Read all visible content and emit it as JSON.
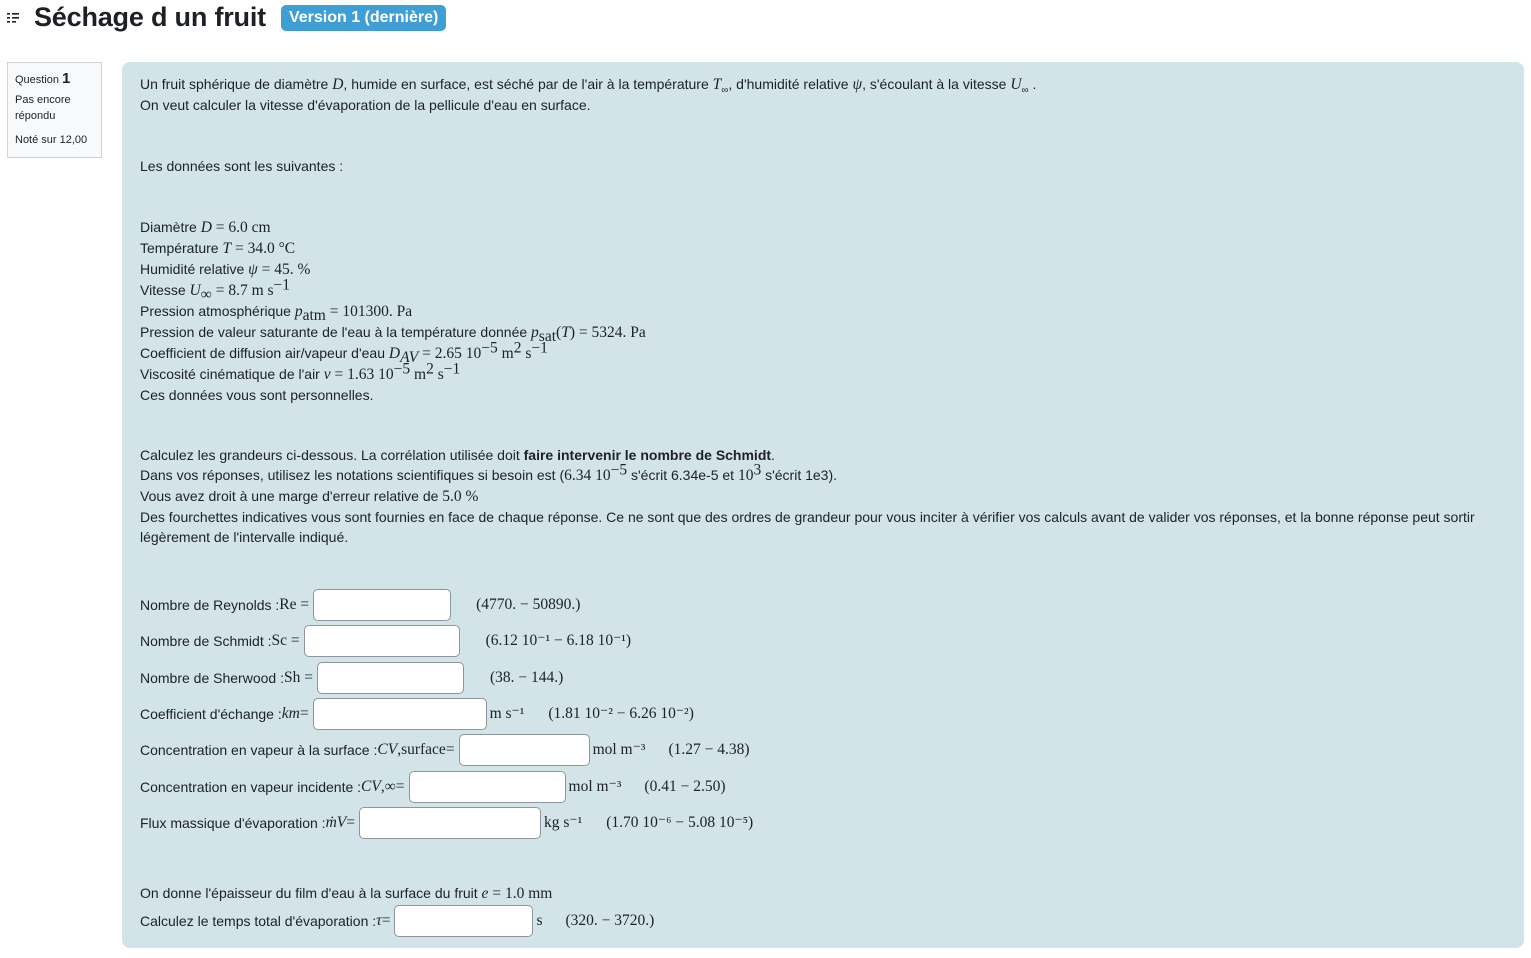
{
  "header": {
    "title": "Séchage d un fruit",
    "version_badge": "Version 1 (dernière)"
  },
  "question_info": {
    "label": "Question",
    "number": "1",
    "state": "Pas encore répondu",
    "grade": "Noté sur 12,00"
  },
  "intro": {
    "line1_a": "Un fruit sphérique de diamètre ",
    "line1_b": ", humide en surface, est séché par de l'air à la température ",
    "line1_c": ", d'humidité relative ",
    "line1_d": ", s'écoulant à la vitesse ",
    "line2": "On veut calculer la vitesse d'évaporation de la pellicule d'eau en surface.",
    "data_intro": "Les données sont les suivantes :"
  },
  "data": {
    "diameter_label": "Diamètre ",
    "diameter_value": "6.0 cm",
    "temperature_label": "Température ",
    "temperature_value": "34.0 °C",
    "humidity_label": "Humidité relative ",
    "humidity_value": "45. %",
    "speed_label": "Vitesse ",
    "speed_value": "8.7 m s",
    "patm_label": "Pression atmosphérique ",
    "patm_value": "101300. Pa",
    "psat_label": "Pression de valeur saturante de l'eau à la température donnée ",
    "psat_value": "5324. Pa",
    "diff_label": "Coefficient de diffusion air/vapeur d'eau ",
    "diff_value": "2.65 10",
    "visc_label": "Viscosité cinématique de l'air ",
    "visc_value": "1.63 10",
    "personal": "Ces données vous sont personnelles."
  },
  "instructions": {
    "line1_a": "Calculez les grandeurs ci-dessous. La corrélation utilisée doit ",
    "line1_bold": "faire intervenir le nombre de Schmidt",
    "line1_b": ".",
    "line2_a": "Dans vos réponses, utilisez les notations scientifiques si besoin est (",
    "line2_b": " s'écrit 6.34e-5 et ",
    "line2_c": " s'écrit 1e3).",
    "line3_a": "Vous avez droit à une marge d'erreur relative de ",
    "line3_value": "5.0 %",
    "line4": "Des fourchettes indicatives vous sont fournies en face de chaque réponse. Ce ne sont que des ordres de grandeur pour vous inciter à vérifier vos calculs avant de valider vos réponses, et la bonne réponse peut sortir légèrement de l'intervalle indiqué."
  },
  "answers": [
    {
      "label": "Nombre de Reynolds : ",
      "unit": "",
      "range": "(4770.  −  50890.)"
    },
    {
      "label": "Nombre de Schmidt : ",
      "unit": "",
      "range": "(6.12 10⁻¹  −  6.18 10⁻¹)"
    },
    {
      "label": "Nombre de Sherwood : ",
      "unit": "",
      "range": "(38.  −  144.)"
    },
    {
      "label": "Coefficient d'échange : ",
      "unit": "m s⁻¹",
      "range": "(1.81 10⁻²  −  6.26 10⁻²)"
    },
    {
      "label": "Concentration en vapeur à la surface : ",
      "unit": "mol m⁻³",
      "range": "(1.27  −  4.38)"
    },
    {
      "label": "Concentration en vapeur incidente : ",
      "unit": "mol m⁻³",
      "range": "(0.41  −  2.50)"
    },
    {
      "label": "Flux massique d'évaporation : ",
      "unit": "kg s⁻¹",
      "range": "(1.70 10⁻⁶  −  5.08 10⁻⁵)"
    }
  ],
  "film": {
    "label": "On donne l'épaisseur du film d'eau à la surface du fruit ",
    "value": "1.0 mm"
  },
  "time_answer": {
    "label": "Calculez le temps total d'évaporation : ",
    "unit": "s",
    "range": "(320.  −  3720.)"
  }
}
